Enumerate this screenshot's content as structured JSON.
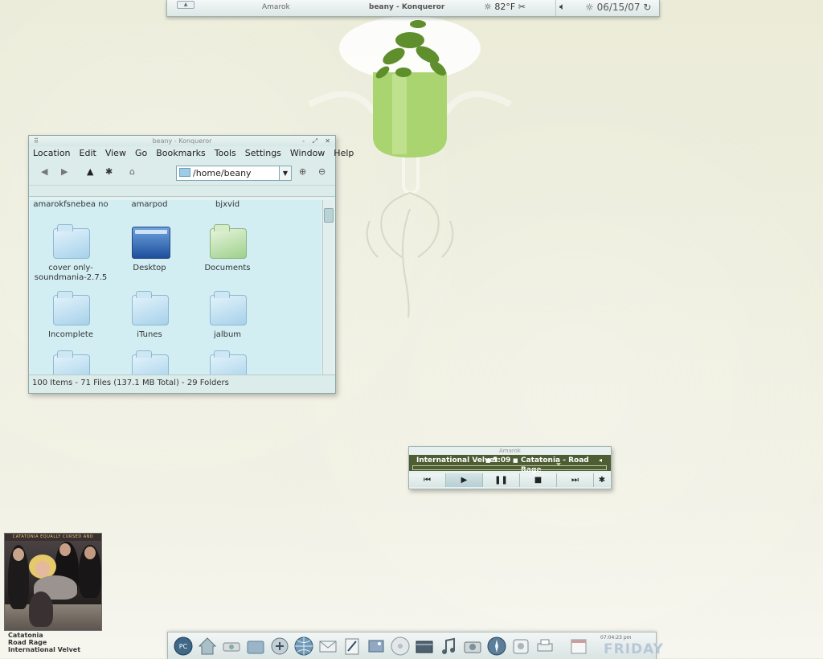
{
  "top_panel": {
    "tasks": [
      "Amarok",
      "beany - Konqueror"
    ],
    "temperature": "82°F",
    "date": "06/15/07"
  },
  "konqueror": {
    "title": "beany - Konqueror",
    "menu": [
      "Location",
      "Edit",
      "View",
      "Go",
      "Bookmarks",
      "Tools",
      "Settings",
      "Window",
      "Help"
    ],
    "url": "/home/beany",
    "files": [
      {
        "name": "amarokfsnebea no",
        "icon": "folder"
      },
      {
        "name": "amarpod",
        "icon": "folder"
      },
      {
        "name": "bjxvid",
        "icon": "folder"
      },
      {
        "name": "cover only-soundmania-2.7.5",
        "icon": "folder"
      },
      {
        "name": "Desktop",
        "icon": "desktop-folder"
      },
      {
        "name": "Documents",
        "icon": "documents-folder"
      },
      {
        "name": "Incomplete",
        "icon": "folder"
      },
      {
        "name": "iTunes",
        "icon": "folder"
      },
      {
        "name": "jalbum",
        "icon": "folder"
      }
    ],
    "status": "100 Items - 71 Files (137.1 MB Total) - 29 Folders"
  },
  "amarok": {
    "title": "Amarok",
    "artist_album": "International Velvet",
    "duration": "5:09",
    "track": "Catatonia - Road Rage",
    "progress": 0.75
  },
  "album": {
    "header": "CATATONIA  EQUALLY CURSED AND BLESSED",
    "artist": "Catatonia",
    "track": "Road Rage",
    "album": "International Velvet"
  },
  "dock": {
    "time": "07:04:23 pm",
    "day": "FRIDAY",
    "icons": [
      "computer-icon",
      "home-icon",
      "network-icon",
      "folder-icon",
      "software-icon",
      "browser-icon",
      "mail-icon",
      "editor-icon",
      "photos-icon",
      "cd-icon",
      "video-icon",
      "music-icon",
      "camera-icon",
      "compass-icon",
      "messenger-icon",
      "printer-icon",
      "calendar-icon"
    ]
  }
}
